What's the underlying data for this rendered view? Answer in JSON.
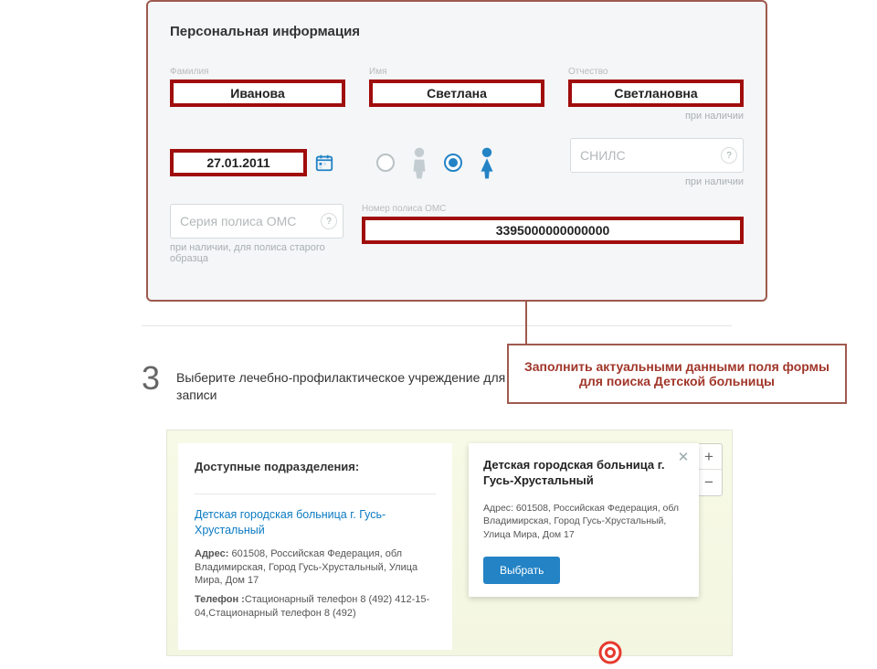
{
  "panel": {
    "title": "Персональная информация",
    "surname": {
      "label": "Фамилия",
      "value": "Иванова"
    },
    "name": {
      "label": "Имя",
      "value": "Светлана"
    },
    "patronym": {
      "label": "Отчество",
      "value": "Светлановна",
      "hint": "при наличии"
    },
    "birthdate": {
      "value": "27.01.2011"
    },
    "snils": {
      "placeholder": "СНИЛС",
      "hint": "при наличии"
    },
    "oms_series": {
      "placeholder": "Серия полиса ОМС",
      "hint": "при наличии, для полиса старого образца"
    },
    "oms_number": {
      "label": "Номер полиса ОМС",
      "value": "3395000000000000"
    }
  },
  "callout": "Заполнить актуальными данными поля формы для поиска Детской больницы",
  "step3": {
    "num": "3",
    "text": "Выберите лечебно-профилактическое учреждение для записи"
  },
  "listing": {
    "title": "Доступные подразделения:",
    "institution_name": "Детская городская больница г. Гусь-Хрустальный",
    "address_label": "Адрес:",
    "address": "601508, Российская Федерация, обл Владимирская, Город Гусь-Хрустальный, Улица Мира, Дом 17",
    "phone_label": "Телефон :",
    "phone": "Стационарный телефон 8 (492) 412-15-04,Стационарный телефон 8 (492)"
  },
  "popup": {
    "title": "Детская городская больница г. Гусь-Хрустальный",
    "address": "Адрес: 601508, Российская Федерация, обл Владимирская, Город Гусь-Хрустальный, Улица Мира, Дом 17",
    "button": "Выбрать"
  },
  "zoom": {
    "in": "+",
    "out": "−"
  }
}
